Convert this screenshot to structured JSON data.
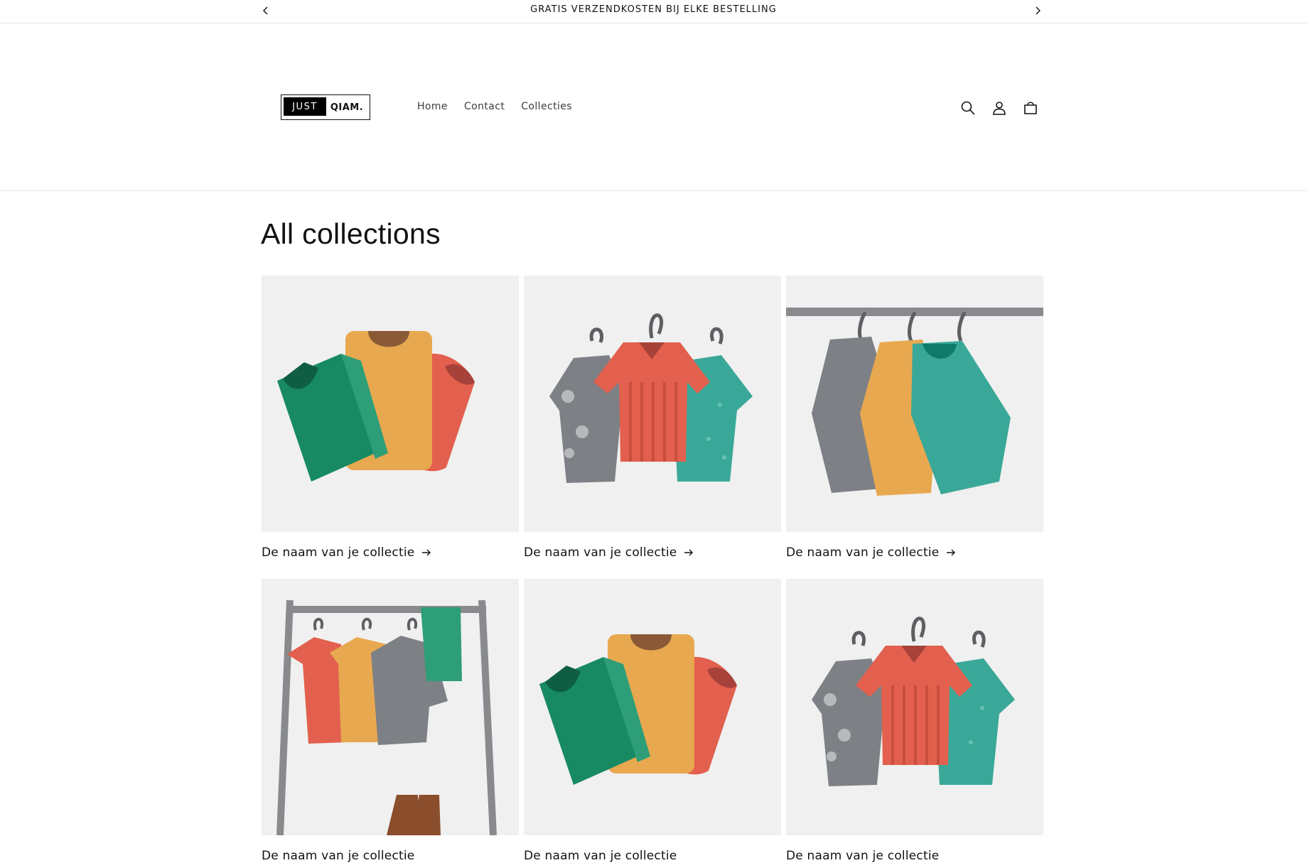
{
  "announcement": {
    "text": "GRATIS VERZENDKOSTEN BIJ ELKE BESTELLING"
  },
  "header": {
    "logo_left": "JUST",
    "logo_right": "QIAM.",
    "nav": [
      "Home",
      "Contact",
      "Collecties"
    ],
    "icons": [
      "search-icon",
      "account-icon",
      "cart-icon"
    ]
  },
  "main": {
    "title": "All collections",
    "collections": [
      {
        "title": "De naam van je collectie",
        "image": "folded-shirts"
      },
      {
        "title": "De naam van je collectie",
        "image": "hanging-shirts"
      },
      {
        "title": "De naam van je collectie",
        "image": "sweaters-on-rail"
      },
      {
        "title": "De naam van je collectie",
        "image": "clothing-rack"
      },
      {
        "title": "De naam van je collectie",
        "image": "folded-shirts"
      },
      {
        "title": "De naam van je collectie",
        "image": "hanging-shirts"
      }
    ]
  },
  "colors": {
    "green": "#178a64",
    "yellow": "#e8a84f",
    "red": "#e2604d",
    "teal": "#3aa898",
    "grey": "#7d8085",
    "placeholder_bg": "#f0f0f0"
  }
}
